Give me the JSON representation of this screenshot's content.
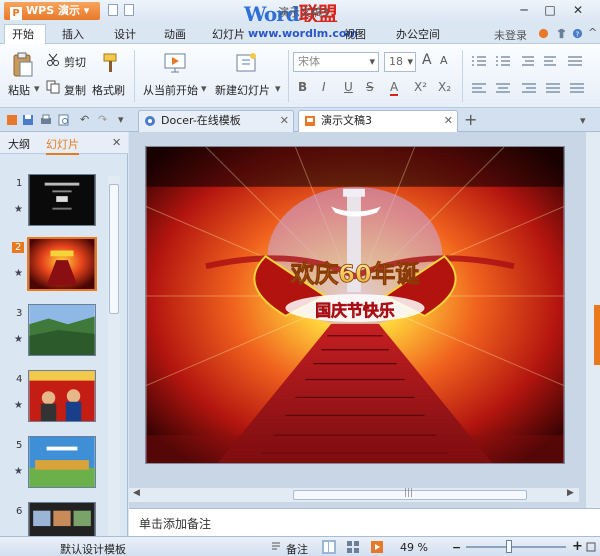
{
  "titlebar": {
    "app_name": "WPS 演示",
    "window_title": "演示文稿3",
    "watermark_a": "Word",
    "watermark_b": "联盟",
    "controls": [
      "─",
      "□",
      "✕"
    ]
  },
  "menu": {
    "items": [
      "开始",
      "插入",
      "设计",
      "动画",
      "幻灯片",
      "视图",
      "办公空间"
    ],
    "watermark_url": "www.wordlm.com",
    "login": "未登录"
  },
  "ribbon": {
    "paste": "粘贴",
    "cut": "剪切",
    "copy": "复制",
    "format_painter": "格式刷",
    "from_current": "从当前开始",
    "new_slide": "新建幻灯片",
    "font_name": "宋体",
    "font_size": "18",
    "format_buttons": [
      "B",
      "I",
      "U",
      "S",
      "A",
      "X²",
      "X₂"
    ],
    "font_grow": "A",
    "font_shrink": "A"
  },
  "tabs": [
    {
      "label": "Docer-在线模板",
      "active": false
    },
    {
      "label": "演示文稿3",
      "active": true
    }
  ],
  "panel": {
    "tab_outline": "大纲",
    "tab_slides": "幻灯片",
    "slides": [
      {
        "num": "1",
        "theme": "dark"
      },
      {
        "num": "2",
        "theme": "red",
        "selected": true
      },
      {
        "num": "3",
        "theme": "green"
      },
      {
        "num": "4",
        "theme": "redpeople"
      },
      {
        "num": "5",
        "theme": "blue"
      },
      {
        "num": "6",
        "theme": "mixed"
      }
    ]
  },
  "slide": {
    "banner_top": "欢庆60年诞",
    "banner_bottom": "国庆节快乐"
  },
  "notes": {
    "placeholder": "单击添加备注"
  },
  "status": {
    "template": "默认设计模板",
    "notes_btn": "备注",
    "zoom": "49 %",
    "zoom_level": 0.49
  },
  "colors": {
    "accent": "#e87a1d",
    "chrome": "#dbe6f3"
  }
}
